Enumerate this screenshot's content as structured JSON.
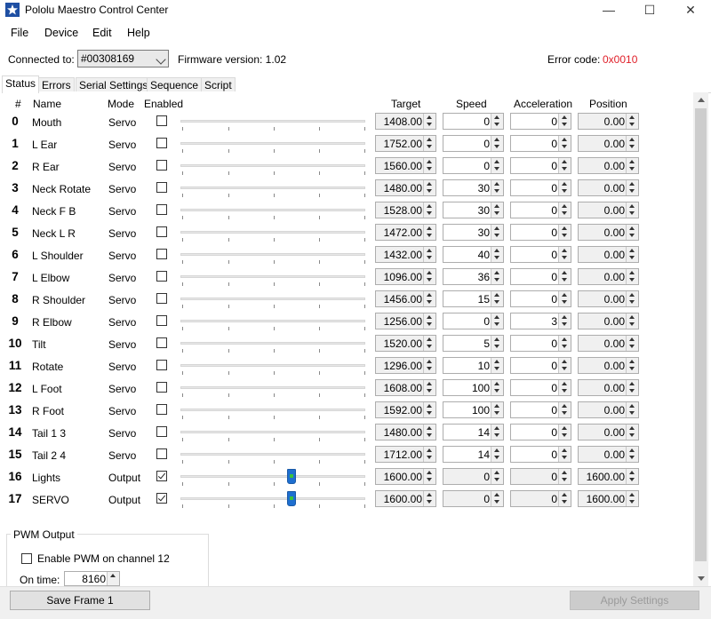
{
  "window": {
    "title": "Pololu Maestro Control Center",
    "minimize": "—",
    "maximize": "☐",
    "close": "✕"
  },
  "menu": [
    "File",
    "Device",
    "Edit",
    "Help"
  ],
  "connection": {
    "label": "Connected to:",
    "device": "#00308169",
    "firmware": "Firmware version: 1.02",
    "error_label": "Error code:",
    "error_code": "0x0010",
    "error_color": "#e0202a"
  },
  "tabs": [
    "Status",
    "Errors",
    "Serial Settings",
    "Sequence",
    "Script"
  ],
  "headers": {
    "num": "#",
    "name": "Name",
    "mode": "Mode",
    "enabled": "Enabled",
    "target": "Target",
    "speed": "Speed",
    "acceleration": "Acceleration",
    "position": "Position"
  },
  "channels": [
    {
      "num": "0",
      "name": "Mouth",
      "mode": "Servo",
      "enabled": false,
      "target": "1408.00",
      "speed": "0",
      "accel": "0",
      "position": "0.00"
    },
    {
      "num": "1",
      "name": "L Ear",
      "mode": "Servo",
      "enabled": false,
      "target": "1752.00",
      "speed": "0",
      "accel": "0",
      "position": "0.00"
    },
    {
      "num": "2",
      "name": "R Ear",
      "mode": "Servo",
      "enabled": false,
      "target": "1560.00",
      "speed": "0",
      "accel": "0",
      "position": "0.00"
    },
    {
      "num": "3",
      "name": "Neck Rotate",
      "mode": "Servo",
      "enabled": false,
      "target": "1480.00",
      "speed": "30",
      "accel": "0",
      "position": "0.00"
    },
    {
      "num": "4",
      "name": "Neck F B",
      "mode": "Servo",
      "enabled": false,
      "target": "1528.00",
      "speed": "30",
      "accel": "0",
      "position": "0.00"
    },
    {
      "num": "5",
      "name": "Neck L R",
      "mode": "Servo",
      "enabled": false,
      "target": "1472.00",
      "speed": "30",
      "accel": "0",
      "position": "0.00"
    },
    {
      "num": "6",
      "name": "L Shoulder",
      "mode": "Servo",
      "enabled": false,
      "target": "1432.00",
      "speed": "40",
      "accel": "0",
      "position": "0.00"
    },
    {
      "num": "7",
      "name": "L Elbow",
      "mode": "Servo",
      "enabled": false,
      "target": "1096.00",
      "speed": "36",
      "accel": "0",
      "position": "0.00"
    },
    {
      "num": "8",
      "name": "R Shoulder",
      "mode": "Servo",
      "enabled": false,
      "target": "1456.00",
      "speed": "15",
      "accel": "0",
      "position": "0.00"
    },
    {
      "num": "9",
      "name": "R Elbow",
      "mode": "Servo",
      "enabled": false,
      "target": "1256.00",
      "speed": "0",
      "accel": "3",
      "position": "0.00"
    },
    {
      "num": "10",
      "name": "Tilt",
      "mode": "Servo",
      "enabled": false,
      "target": "1520.00",
      "speed": "5",
      "accel": "0",
      "position": "0.00"
    },
    {
      "num": "11",
      "name": "Rotate",
      "mode": "Servo",
      "enabled": false,
      "target": "1296.00",
      "speed": "10",
      "accel": "0",
      "position": "0.00"
    },
    {
      "num": "12",
      "name": "L Foot",
      "mode": "Servo",
      "enabled": false,
      "target": "1608.00",
      "speed": "100",
      "accel": "0",
      "position": "0.00"
    },
    {
      "num": "13",
      "name": "R Foot",
      "mode": "Servo",
      "enabled": false,
      "target": "1592.00",
      "speed": "100",
      "accel": "0",
      "position": "0.00"
    },
    {
      "num": "14",
      "name": "Tail 1 3",
      "mode": "Servo",
      "enabled": false,
      "target": "1480.00",
      "speed": "14",
      "accel": "0",
      "position": "0.00"
    },
    {
      "num": "15",
      "name": "Tail 2 4",
      "mode": "Servo",
      "enabled": false,
      "target": "1712.00",
      "speed": "14",
      "accel": "0",
      "position": "0.00"
    },
    {
      "num": "16",
      "name": "Lights",
      "mode": "Output",
      "enabled": true,
      "target": "1600.00",
      "speed": "0",
      "accel": "0",
      "position": "1600.00",
      "slider_level": 0.6
    },
    {
      "num": "17",
      "name": "SERVO",
      "mode": "Output",
      "enabled": true,
      "target": "1600.00",
      "speed": "0",
      "accel": "0",
      "position": "1600.00",
      "slider_level": 0.6
    }
  ],
  "pwm": {
    "title": "PWM Output",
    "enable_label": "Enable PWM on channel 12",
    "on_time_label": "On time:",
    "on_time_value": "8160"
  },
  "buttons": {
    "save_frame": "Save Frame 1",
    "apply_settings": "Apply Settings"
  },
  "colors": {
    "slider_thumb": "#1e6fd0",
    "app_icon": "#1e4fa3"
  }
}
